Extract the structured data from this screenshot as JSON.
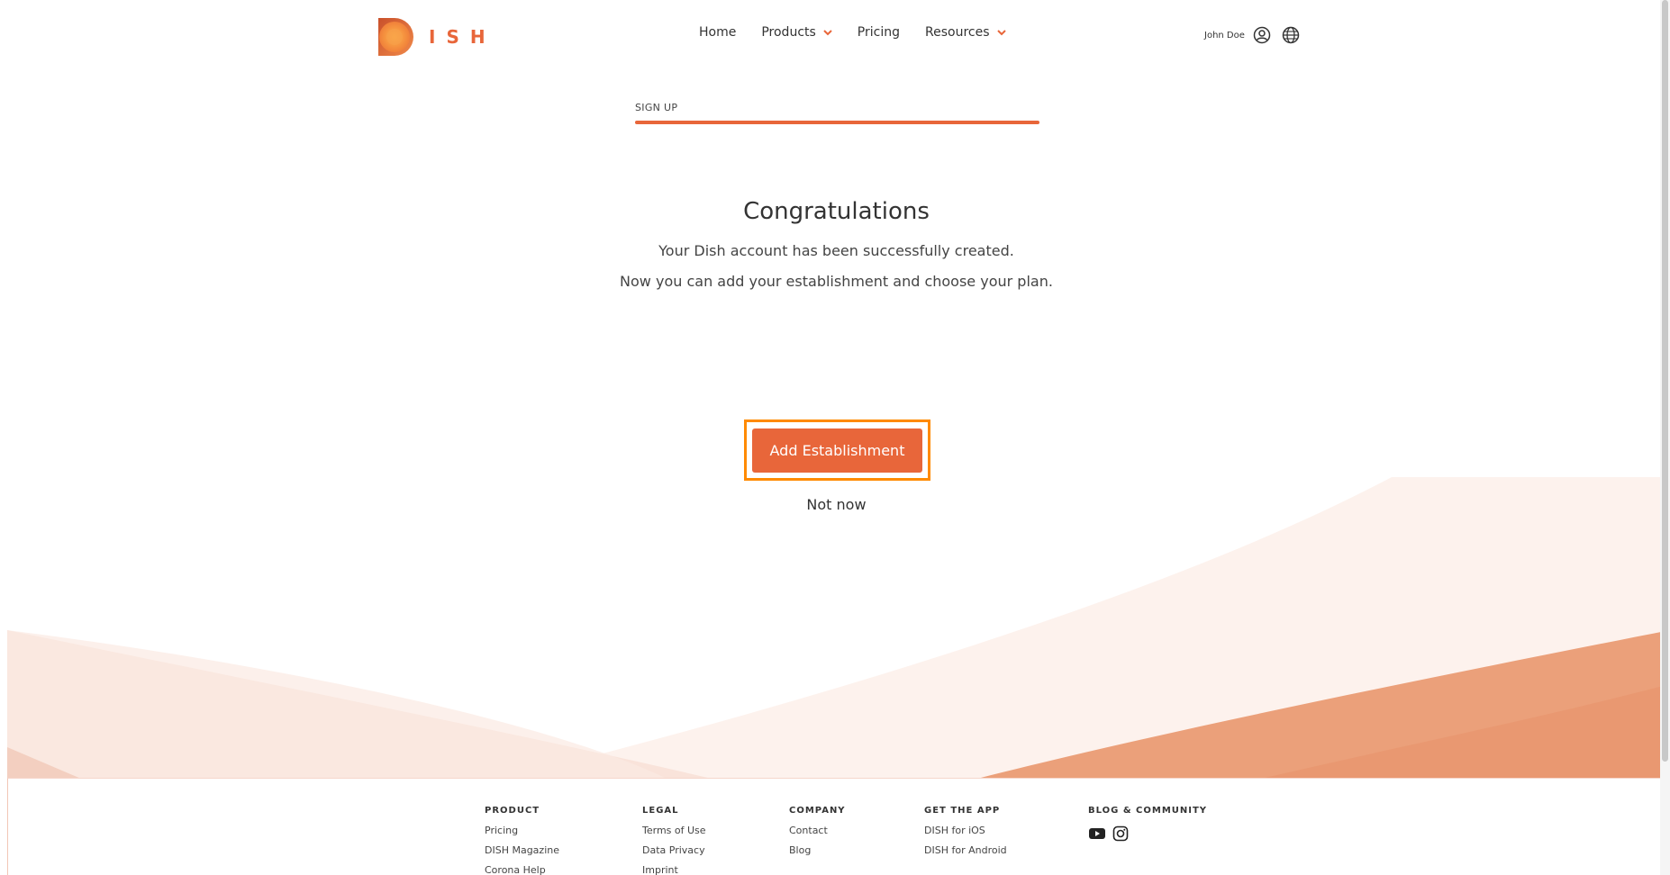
{
  "header": {
    "logo_letters": "ISH",
    "nav": [
      {
        "label": "Home",
        "has_dropdown": false
      },
      {
        "label": "Products",
        "has_dropdown": true
      },
      {
        "label": "Pricing",
        "has_dropdown": false
      },
      {
        "label": "Resources",
        "has_dropdown": true
      }
    ],
    "user_name": "John Doe",
    "icons": {
      "user": "user-circle-icon",
      "language": "globe-icon"
    }
  },
  "signup": {
    "step_label": "SIGN UP",
    "progress": 1.0
  },
  "content": {
    "title": "Congratulations",
    "message1": "Your Dish account has been successfully created.",
    "message2": "Now you can add your establishment and choose your plan.",
    "primary_button": "Add Establishment",
    "secondary_link": "Not now"
  },
  "footer": {
    "columns": [
      {
        "heading": "PRODUCT",
        "links": [
          "Pricing",
          "DISH Magazine",
          "Corona Help"
        ]
      },
      {
        "heading": "LEGAL",
        "links": [
          "Terms of Use",
          "Data Privacy",
          "Imprint"
        ]
      },
      {
        "heading": "COMPANY",
        "links": [
          "Contact",
          "Blog"
        ]
      },
      {
        "heading": "GET THE APP",
        "links": [
          "DISH for iOS",
          "DISH for Android"
        ]
      },
      {
        "heading": "BLOG & COMMUNITY",
        "social": [
          "youtube-icon",
          "instagram-icon"
        ]
      }
    ]
  },
  "colors": {
    "accent": "#e8663a",
    "highlight": "#ff8a00",
    "text": "#333333"
  }
}
